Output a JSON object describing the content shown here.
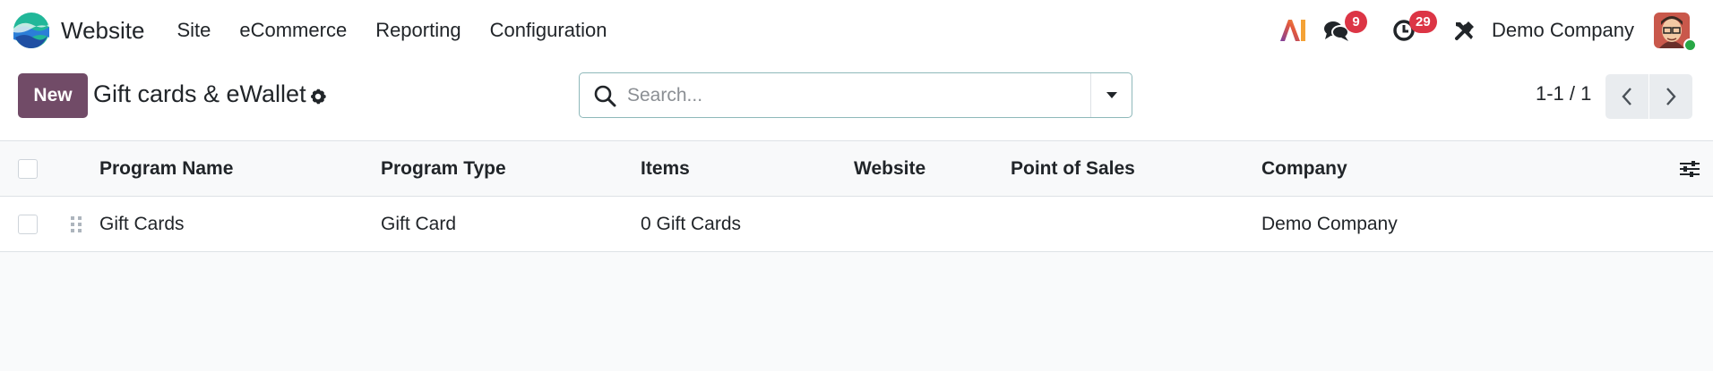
{
  "navbar": {
    "app_name": "Website",
    "menu": [
      {
        "label": "Site"
      },
      {
        "label": "eCommerce"
      },
      {
        "label": "Reporting"
      },
      {
        "label": "Configuration"
      }
    ],
    "systray": {
      "messages_count": "9",
      "activities_count": "29",
      "company": "Demo Company"
    }
  },
  "control_panel": {
    "new_label": "New",
    "title": "Gift cards & eWallet",
    "search_placeholder": "Search...",
    "pager": "1-1 / 1"
  },
  "table": {
    "columns": [
      "Program Name",
      "Program Type",
      "Items",
      "Website",
      "Point of Sales",
      "Company"
    ],
    "rows": [
      {
        "program_name": "Gift Cards",
        "program_type": "Gift Card",
        "items": "0 Gift Cards",
        "website": "",
        "point_of_sales": "",
        "company": "Demo Company"
      }
    ]
  },
  "colors": {
    "brand": "#714b67",
    "badge": "#dc3545",
    "search_border": "#8eb8ba"
  }
}
